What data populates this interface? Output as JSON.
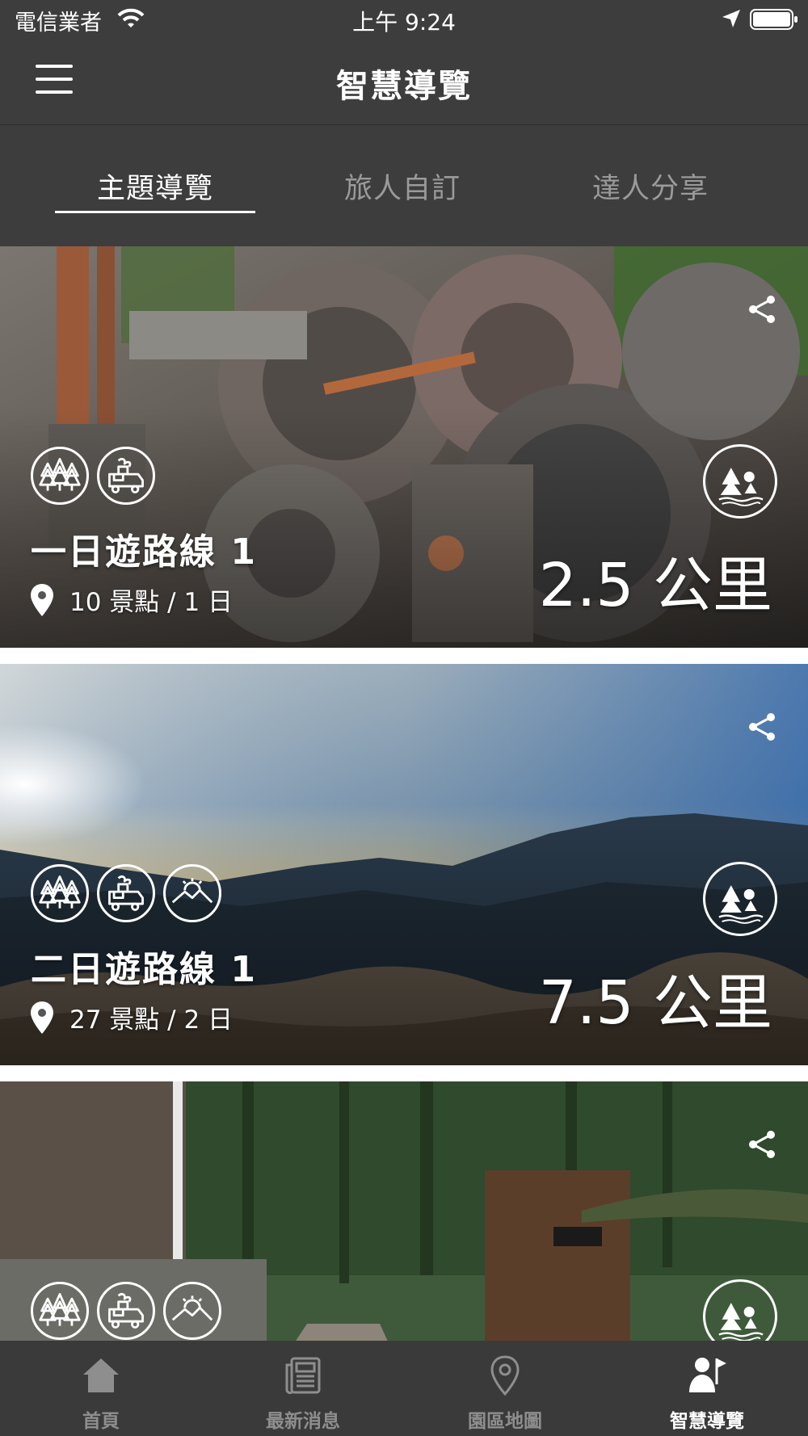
{
  "status_bar": {
    "carrier": "電信業者",
    "time": "上午 9:24"
  },
  "header": {
    "title": "智慧導覽"
  },
  "tabs": [
    {
      "label": "主題導覽",
      "active": true
    },
    {
      "label": "旅人自訂",
      "active": false
    },
    {
      "label": "達人分享",
      "active": false
    }
  ],
  "routes": [
    {
      "title": "一日遊路線 1",
      "spots": "10 景點 / 1 日",
      "distance": "2.5 公里",
      "categories": [
        "forest-icon",
        "train-icon"
      ],
      "theme": "rusty-machinery"
    },
    {
      "title": "二日遊路線 1",
      "spots": "27 景點 / 2 日",
      "distance": "7.5 公里",
      "categories": [
        "forest-icon",
        "train-icon",
        "sunrise-mountain-icon"
      ],
      "theme": "mountain-sunrise"
    },
    {
      "title": "",
      "spots": "",
      "distance": "",
      "categories": [
        "forest-icon",
        "train-icon",
        "sunrise-mountain-icon"
      ],
      "theme": "forest-railway"
    }
  ],
  "tabbar": [
    {
      "label": "首頁",
      "icon": "home-icon",
      "active": false
    },
    {
      "label": "最新消息",
      "icon": "newspaper-icon",
      "active": false
    },
    {
      "label": "園區地圖",
      "icon": "map-pin-icon",
      "active": false
    },
    {
      "label": "智慧導覽",
      "icon": "guide-flag-icon",
      "active": true
    }
  ],
  "colors": {
    "bar_bg": "#3d3d3d",
    "inactive": "#9a9a9a",
    "active": "#ffffff"
  }
}
